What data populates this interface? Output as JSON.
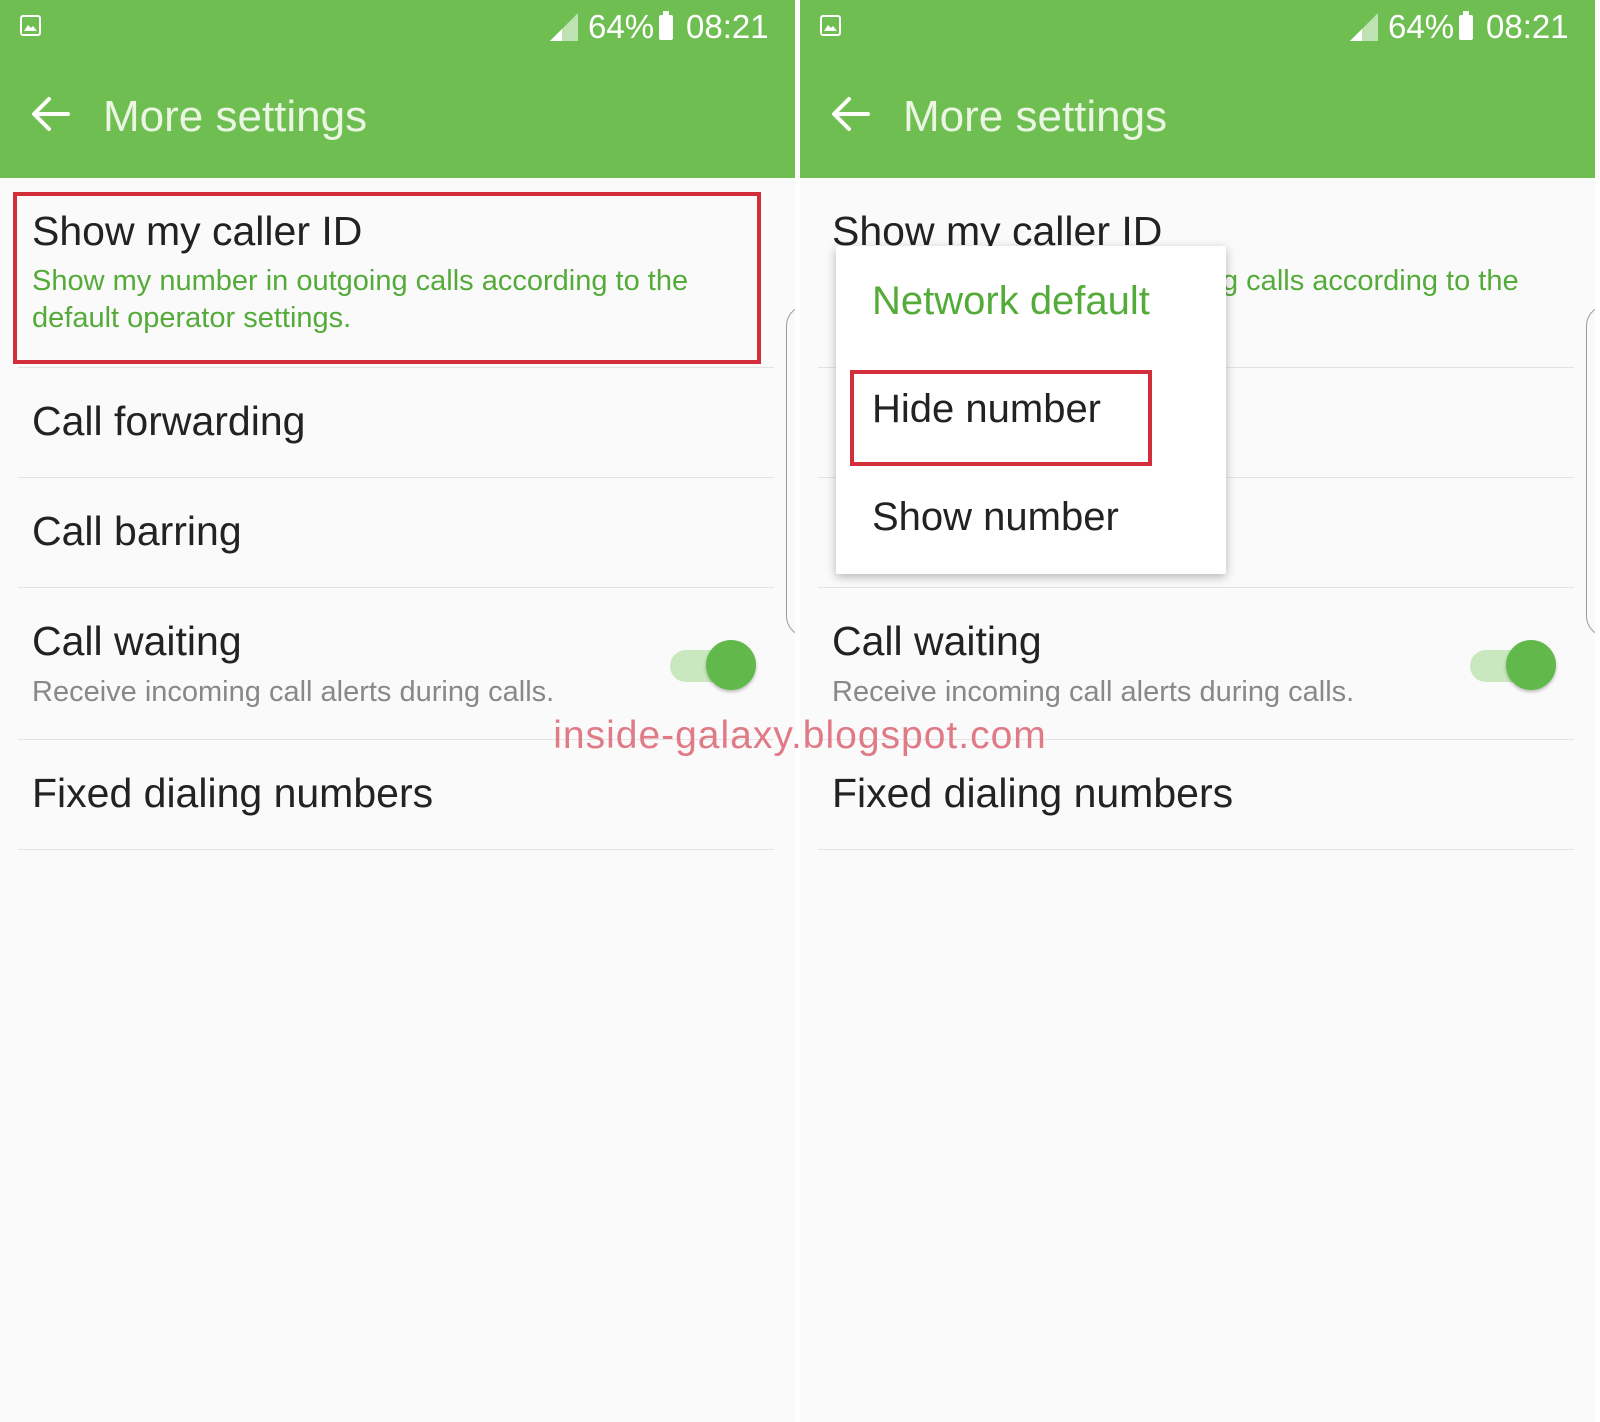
{
  "status_bar": {
    "battery": "64%",
    "time": "08:21",
    "icons": [
      "gallery-icon",
      "signal-icon",
      "battery-icon"
    ]
  },
  "app_bar": {
    "title": "More settings",
    "back_icon": "back-arrow-icon"
  },
  "settings": {
    "caller_id_title": "Show my caller ID",
    "caller_id_sub_line1": "Show my number in outgoing calls according to the",
    "caller_id_sub_line2": "default operator settings.",
    "caller_id_sub_line1_partial": "g calls according to the",
    "caller_id_title_partial": "Show my caller ID",
    "call_forwarding": "Call forwarding",
    "call_barring": "Call barring",
    "call_waiting_title": "Call waiting",
    "call_waiting_sub": "Receive incoming call alerts during calls.",
    "call_waiting_enabled": true,
    "fixed_dialing": "Fixed dialing numbers"
  },
  "popup": {
    "options": [
      "Network default",
      "Hide number",
      "Show number"
    ],
    "selected": "Network default",
    "highlighted": "Hide number"
  },
  "watermark": "inside-galaxy.blogspot.com",
  "colors": {
    "header_green": "#6fbe52",
    "accent_green": "#55ab3a",
    "highlight_red": "#d32f3a",
    "watermark_pink": "#e07a86"
  }
}
